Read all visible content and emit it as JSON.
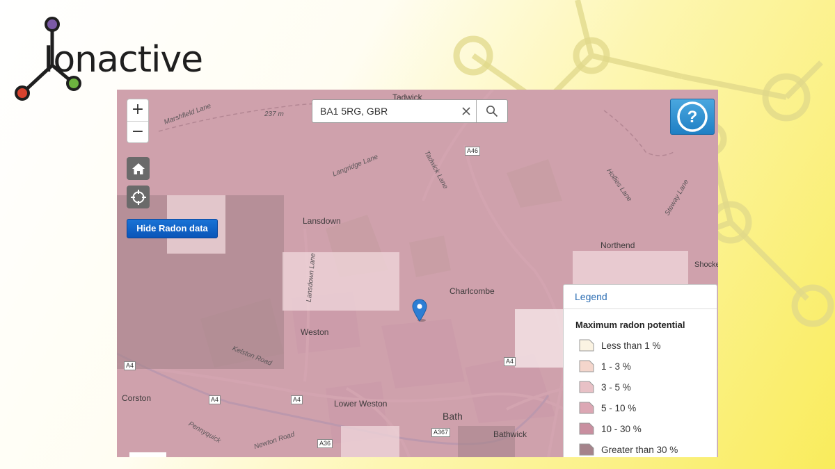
{
  "logo": {
    "text": "Ionactive"
  },
  "map": {
    "search": {
      "value": "BA1 5RG, GBR"
    },
    "zoom": {
      "in_label": "+",
      "out_label": "−"
    },
    "hide_button_label": "Hide Radon data",
    "help_label": "?",
    "places": {
      "tadwick": "Tadwick",
      "lansdown": "Lansdown",
      "northend": "Northend",
      "charlcombe": "Charlcombe",
      "weston": "Weston",
      "corston": "Corston",
      "lower_weston": "Lower Weston",
      "bath": "Bath",
      "bathwick": "Bathwick",
      "shocke": "Shocke"
    },
    "roads": {
      "marshfield_lane": "Marshfield Lane",
      "elevation": "237 m",
      "langridge_lane": "Langridge Lane",
      "tadwick_lane": "Tadwick Lane",
      "hollies_lane": "Hollies Lane",
      "steway_lane": "Steway Lane",
      "lansdown_lane": "Lansdown Lane",
      "kelston_road": "Kelston Road",
      "pennyquick": "Pennyquick",
      "newton_road": "Newton Road"
    },
    "shields": {
      "a46": "A46",
      "a4_left": "A4",
      "a4_mid1": "A4",
      "a4_mid2": "A4",
      "a4_right": "A4",
      "a36": "A36",
      "a367": "A367"
    }
  },
  "legend": {
    "header": "Legend",
    "title": "Maximum radon potential",
    "items": [
      {
        "label": "Less than 1 %",
        "color": "#fbf3e2"
      },
      {
        "label": "1 - 3 %",
        "color": "#f4d6cc"
      },
      {
        "label": "3 - 5 %",
        "color": "#e8c1c6"
      },
      {
        "label": "5 - 10 %",
        "color": "#dca7b4"
      },
      {
        "label": "10 - 30 %",
        "color": "#c98fa0"
      },
      {
        "label": "Greater than 30 %",
        "color": "#a5838b"
      }
    ]
  },
  "colors": {
    "radon_main": "#c98fa0",
    "radon_dark": "#a5838b",
    "radon_light": "#e8c1c6",
    "button_blue": "#0f64c8"
  }
}
